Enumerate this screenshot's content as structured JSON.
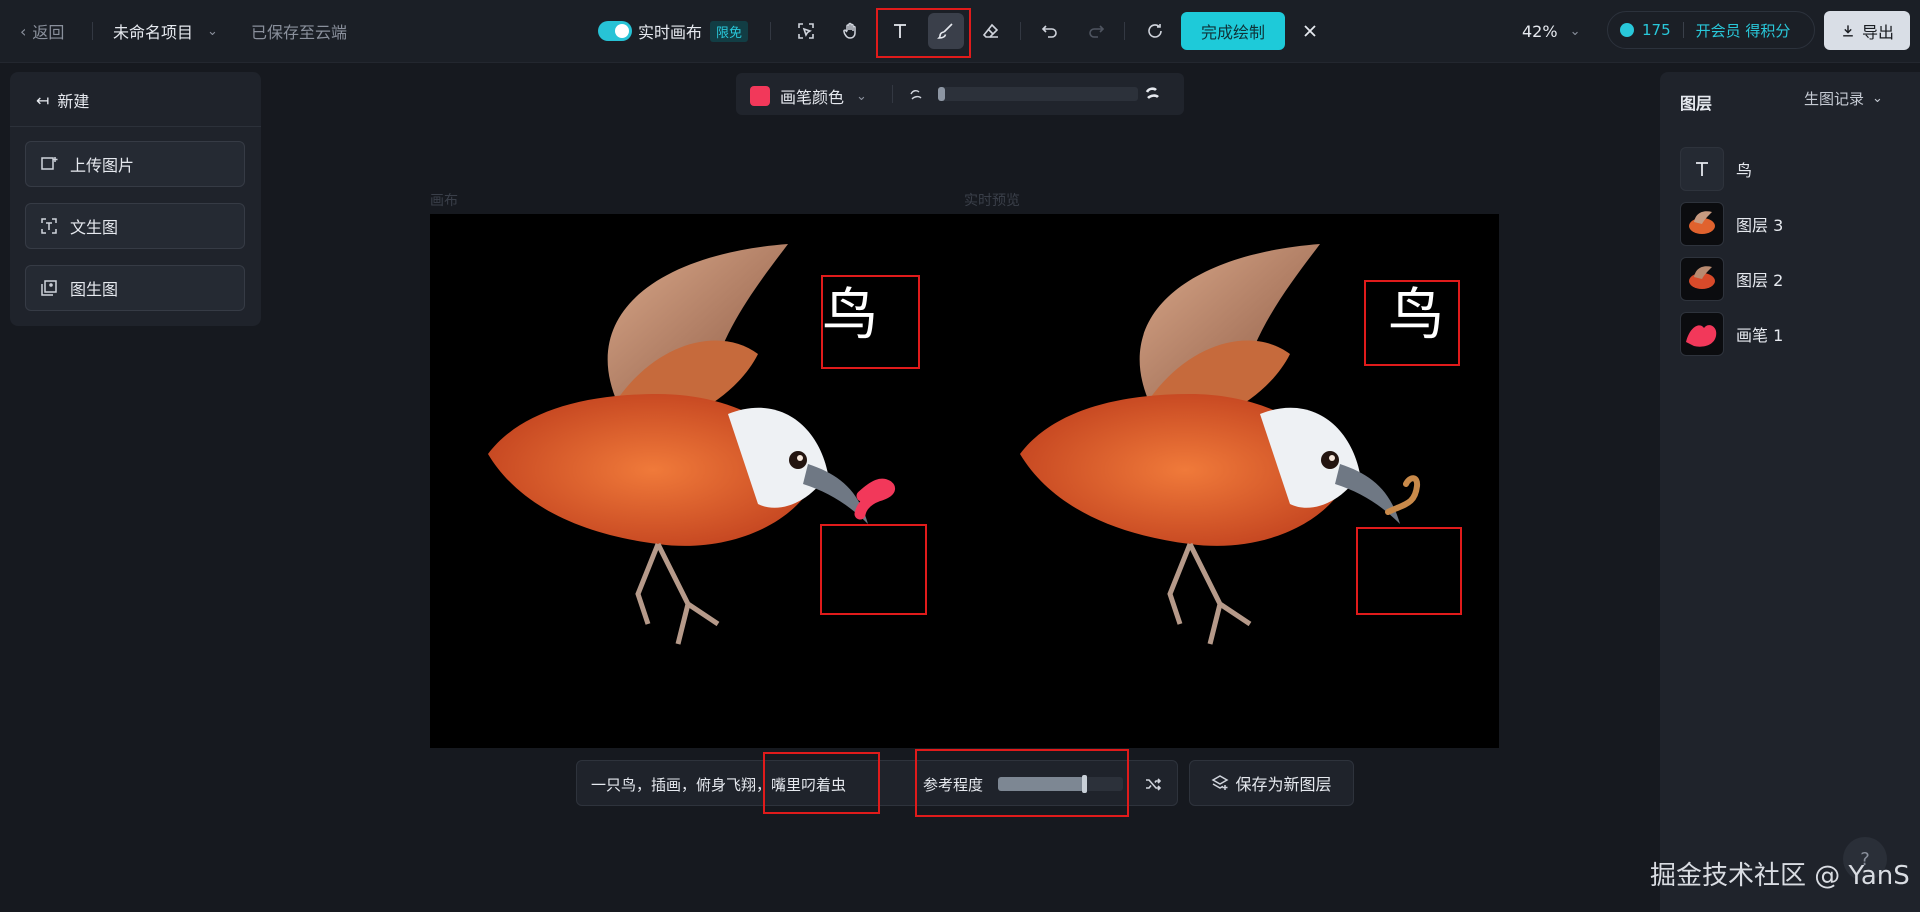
{
  "topbar": {
    "back_label": "返回",
    "project_name": "未命名项目",
    "saved_status": "已保存至云端",
    "realtime_label": "实时画布",
    "free_tag": "限免",
    "finish_label": "完成绘制",
    "zoom": "42%",
    "credits": "175",
    "membership_label": "开会员 得积分",
    "export_label": "导出"
  },
  "left_panel": {
    "new_label": "新建",
    "items": [
      {
        "label": "上传图片",
        "icon": "upload-image-icon"
      },
      {
        "label": "文生图",
        "icon": "text-to-image-icon"
      },
      {
        "label": "图生图",
        "icon": "image-to-image-icon"
      }
    ]
  },
  "brush_bar": {
    "color_label": "画笔颜色",
    "brush_color": "#f2385a",
    "brush_size_fraction": 0.02
  },
  "canvas": {
    "left_label": "画布",
    "right_label": "实时预览",
    "left_text": "鸟",
    "right_text": "鸟"
  },
  "prompt_bar": {
    "prompt_text": "一只鸟，插画，俯身飞翔，嘴里叼着虫",
    "reference_label": "参考程度",
    "reference_fraction": 0.75,
    "save_label": "保存为新图层"
  },
  "right_panel": {
    "title": "图层",
    "history_label": "生图记录",
    "layers": [
      {
        "name": "鸟",
        "type": "text"
      },
      {
        "name": "图层 3",
        "type": "image"
      },
      {
        "name": "图层 2",
        "type": "image"
      },
      {
        "name": "画笔 1",
        "type": "brush"
      }
    ]
  },
  "watermark": "掘金技术社区 @ YanS",
  "help_label": "?",
  "colors": {
    "accent": "#1ecad9",
    "highlight_box": "#e01b1b",
    "bird_orange": "#e0622e"
  }
}
